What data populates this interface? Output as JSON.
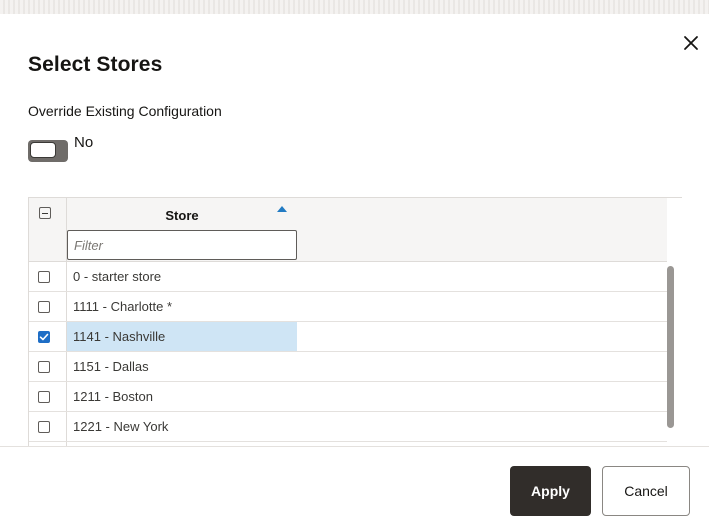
{
  "dialog": {
    "title": "Select Stores",
    "close_icon": "close-icon"
  },
  "override": {
    "label": "Override Existing Configuration",
    "toggle_value": "No",
    "enabled": false
  },
  "table": {
    "column_header": "Store",
    "sort_direction": "ascending",
    "filter_placeholder": "Filter",
    "filter_value": "",
    "rows": [
      {
        "label": "0 - starter store",
        "selected": false
      },
      {
        "label": "1111 - Charlotte *",
        "selected": false
      },
      {
        "label": "1141 - Nashville",
        "selected": true
      },
      {
        "label": "1151 - Dallas",
        "selected": false
      },
      {
        "label": "1211 - Boston",
        "selected": false
      },
      {
        "label": "1221 - New York",
        "selected": false
      }
    ]
  },
  "footer": {
    "apply_label": "Apply",
    "cancel_label": "Cancel"
  },
  "colors": {
    "primary_button": "#312d2a",
    "selection_highlight": "#cfe5f5",
    "checkbox_checked": "#1e6ec6",
    "sort_indicator": "#227bc3"
  }
}
